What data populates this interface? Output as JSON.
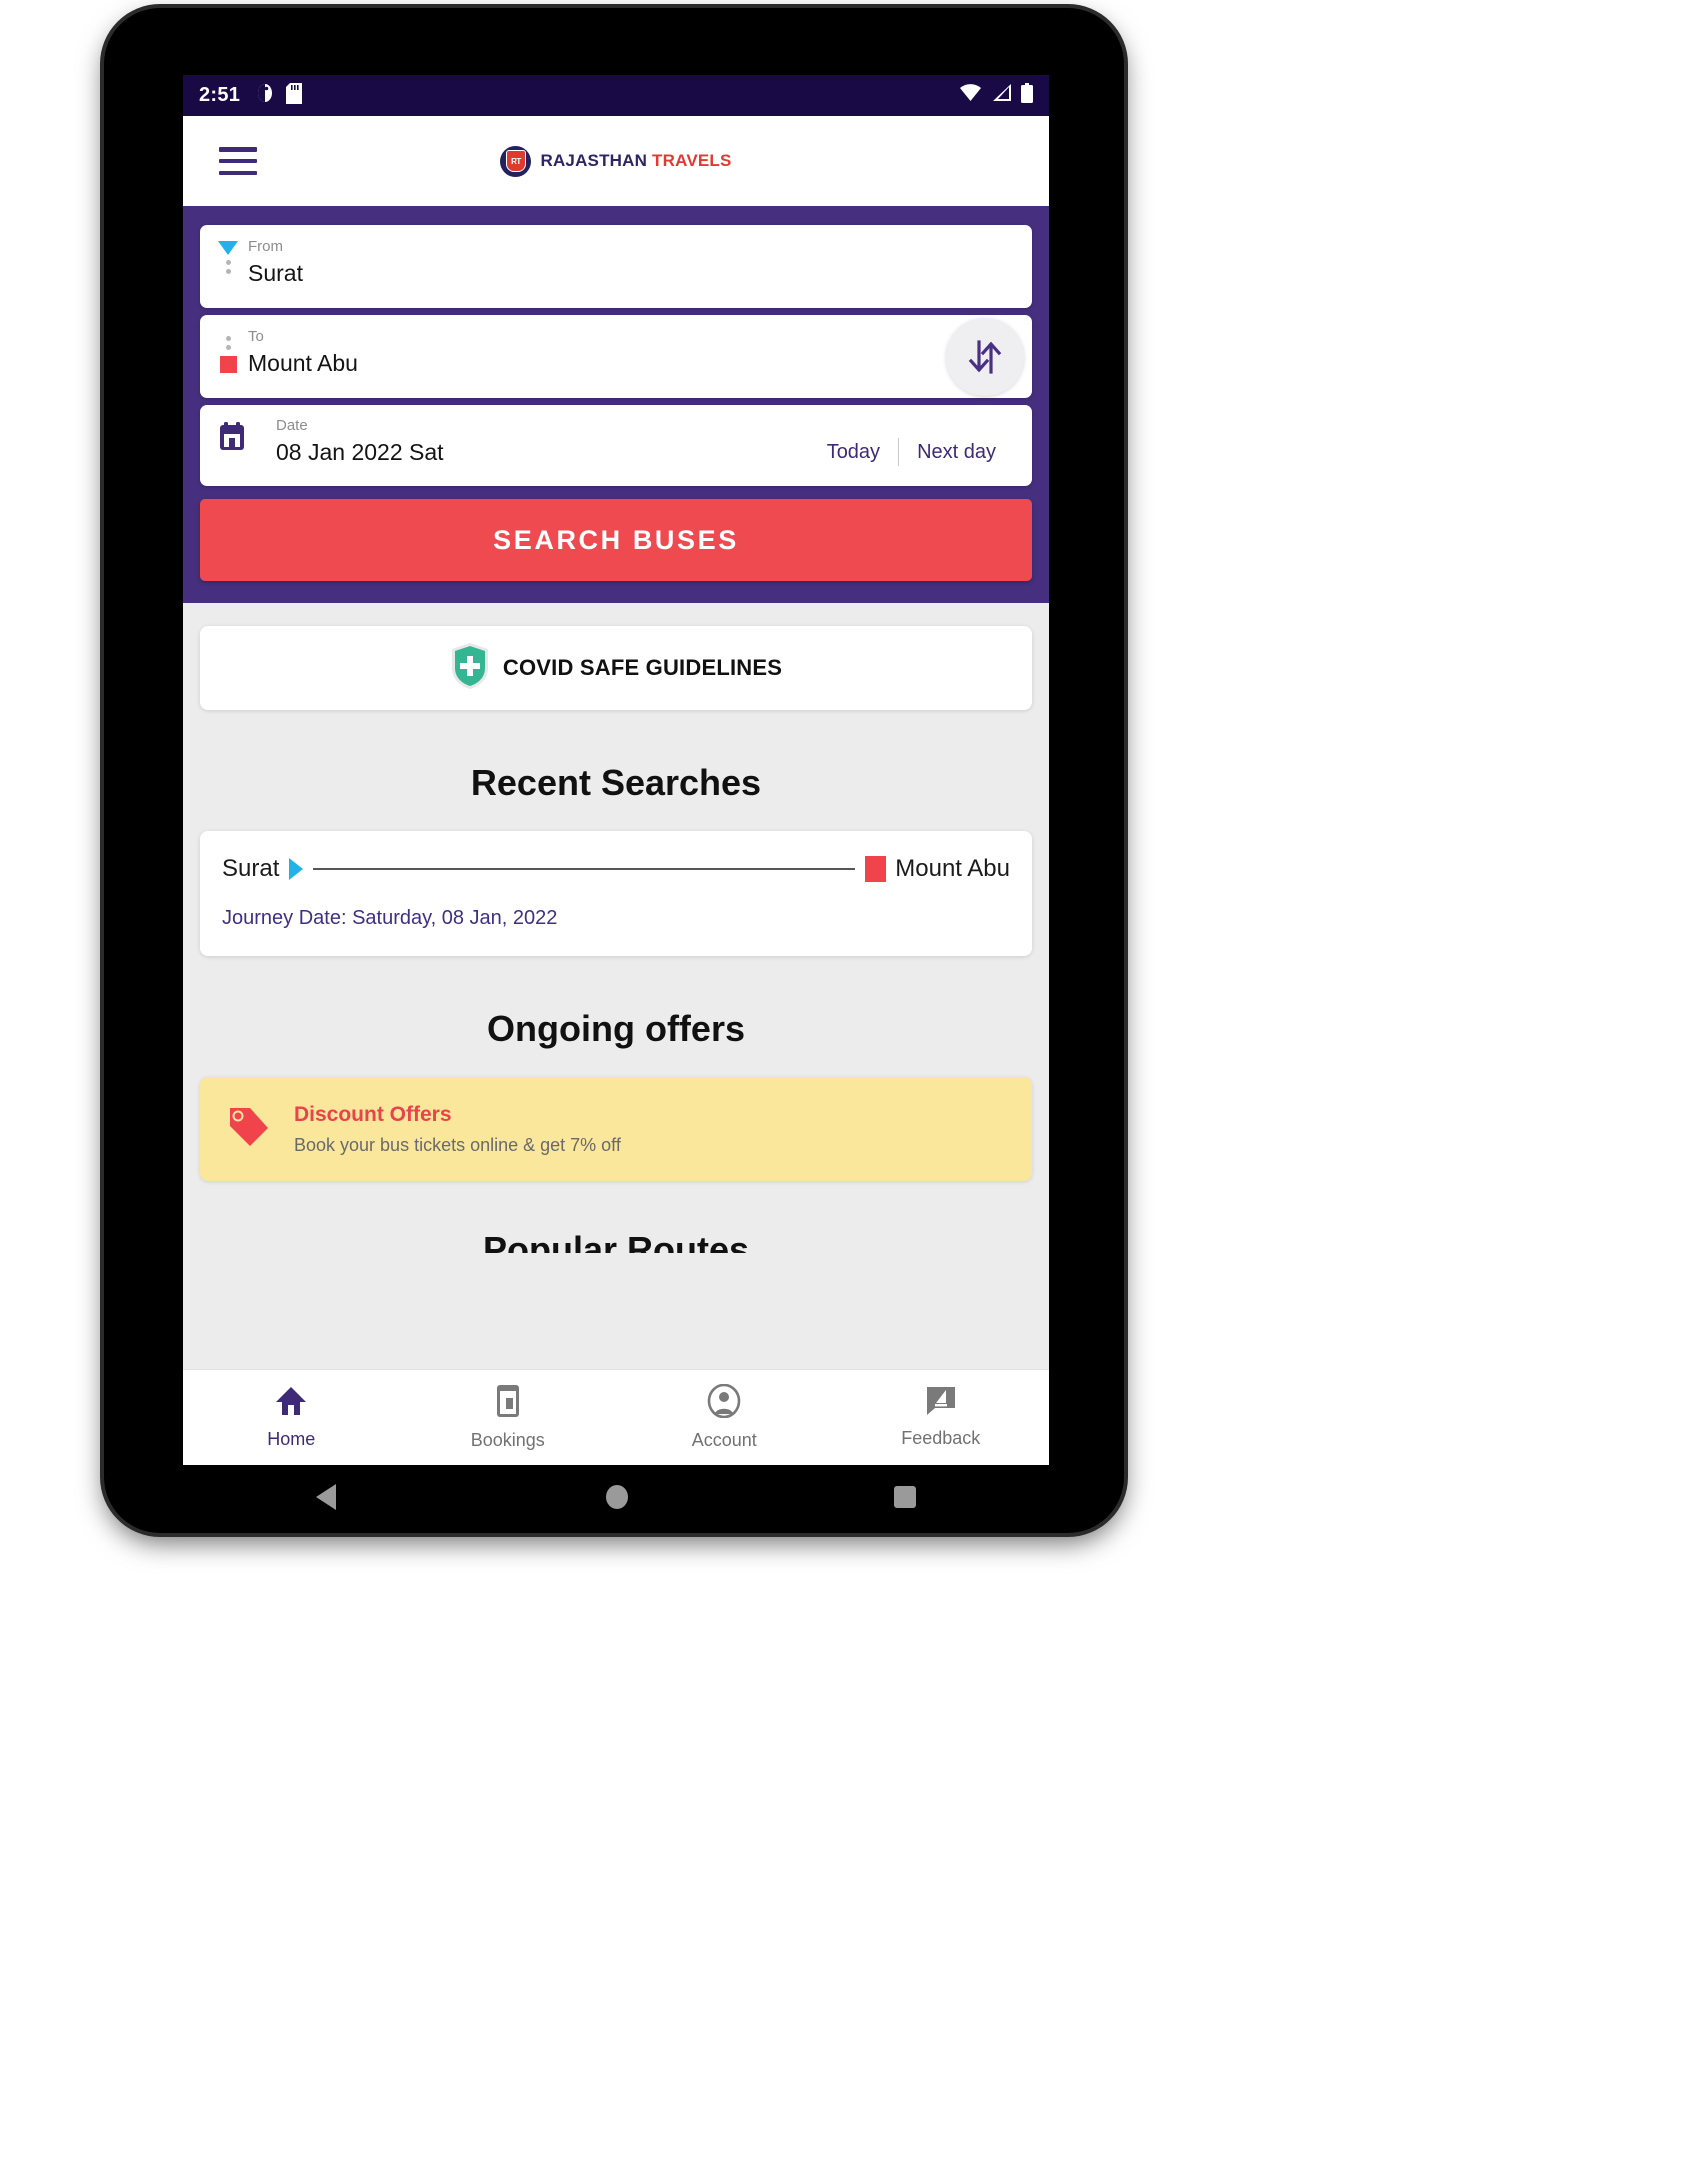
{
  "status_bar": {
    "time": "2:51",
    "left_icons": [
      "screen-rotation-icon",
      "sd-card-icon"
    ],
    "right_icons": [
      "wifi-icon",
      "signal-icon",
      "battery-icon"
    ],
    "background": "#190a46"
  },
  "app_bar": {
    "menu_icon": "hamburger-menu-icon",
    "brand": {
      "badge_text": "RT",
      "name_part1": "RAJASTHAN",
      "name_part2": "TRAVELS",
      "color1": "#2d2566",
      "color2": "#e03a32"
    }
  },
  "search_panel": {
    "background": "#462f7e",
    "from": {
      "label": "From",
      "value": "Surat",
      "marker": "triangle-down-cyan"
    },
    "to": {
      "label": "To",
      "value": "Mount Abu",
      "marker": "square-red"
    },
    "swap_icon": "swap-vertical-arrows-icon",
    "date": {
      "label": "Date",
      "value": "08 Jan 2022 Sat",
      "icon": "calendar-icon",
      "today_label": "Today",
      "next_day_label": "Next day"
    },
    "search_button": "SEARCH BUSES",
    "search_button_color": "#f04a51"
  },
  "covid_banner": {
    "icon": "shield-cross-icon",
    "label": "COVID SAFE GUIDELINES",
    "shield_color": "#35b693"
  },
  "recent_searches": {
    "title": "Recent Searches",
    "items": [
      {
        "from": "Surat",
        "to": "Mount Abu",
        "journey_date": "Journey Date: Saturday, 08 Jan, 2022"
      }
    ]
  },
  "ongoing_offers": {
    "title": "Ongoing offers",
    "items": [
      {
        "icon": "price-tag-icon",
        "title": "Discount Offers",
        "subtitle": "Book your bus tickets online & get 7% off",
        "background": "#fae79c"
      }
    ]
  },
  "popular_routes": {
    "title": "Popular Routes"
  },
  "bottom_nav": {
    "items": [
      {
        "label": "Home",
        "icon": "home-icon",
        "active": true
      },
      {
        "label": "Bookings",
        "icon": "ticket-phone-icon",
        "active": false
      },
      {
        "label": "Account",
        "icon": "account-circle-icon",
        "active": false
      },
      {
        "label": "Feedback",
        "icon": "feedback-speech-icon",
        "active": false
      }
    ],
    "active_color": "#3e2a77",
    "inactive_color": "#727272"
  },
  "android_nav": {
    "back": "back-triangle-icon",
    "home": "home-circle-icon",
    "recents": "recents-square-icon"
  }
}
